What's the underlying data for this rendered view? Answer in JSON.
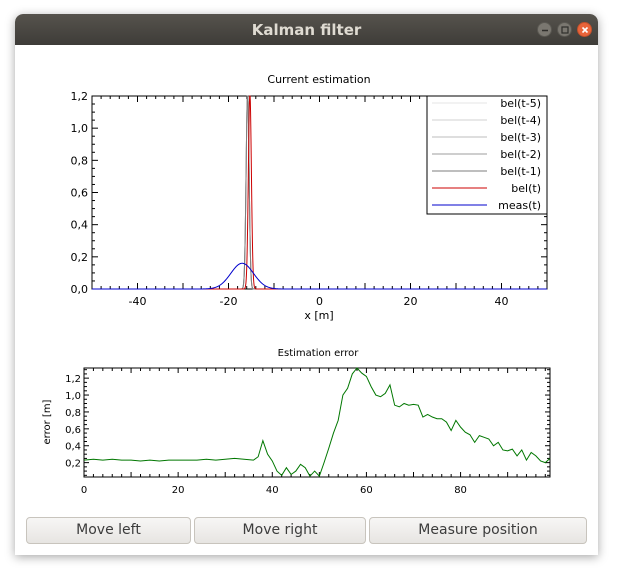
{
  "window": {
    "title": "Kalman filter"
  },
  "top_plot": {
    "title": "Current estimation",
    "xlabel": "x [m]",
    "x_ticks": [
      "-40",
      "-20",
      "0",
      "20",
      "40"
    ],
    "y_ticks": [
      "0,0",
      "0,2",
      "0,4",
      "0,6",
      "0,8",
      "1,0",
      "1,2"
    ],
    "legend": [
      {
        "label": "bel(t-5)",
        "color": "#e4e4e4"
      },
      {
        "label": "bel(t-4)",
        "color": "#d2d2d2"
      },
      {
        "label": "bel(t-3)",
        "color": "#bcbcbc"
      },
      {
        "label": "bel(t-2)",
        "color": "#9e9e9e"
      },
      {
        "label": "bel(t-1)",
        "color": "#7e7e7e"
      },
      {
        "label": "bel(t)",
        "color": "#cc0000"
      },
      {
        "label": "meas(t)",
        "color": "#0000cc"
      }
    ]
  },
  "bottom_plot": {
    "title": "Estimation error",
    "ylabel": "error [m]",
    "x_ticks": [
      "0",
      "20",
      "40",
      "60",
      "80"
    ],
    "y_ticks": [
      "0,2",
      "0,4",
      "0,6",
      "0,8",
      "1,0",
      "1,2"
    ],
    "line_color": "#007700"
  },
  "buttons": {
    "move_left": "Move left",
    "move_right": "Move right",
    "measure": "Measure position"
  },
  "chart_data": [
    {
      "type": "line",
      "title": "Current estimation",
      "xlabel": "x [m]",
      "ylabel": "",
      "xlim": [
        -50,
        50
      ],
      "ylim": [
        0,
        1.2
      ],
      "x_ticks": [
        -40,
        -20,
        0,
        20,
        40
      ],
      "y_ticks": [
        0,
        0.2,
        0.4,
        0.6,
        0.8,
        1.0,
        1.2
      ],
      "grid": false,
      "legend_position": "top-right",
      "series": [
        {
          "name": "bel(t-5)",
          "color": "#e4e4e4",
          "shape": "gaussian",
          "mean": -15.8,
          "sigma": 0.33,
          "peak": 1.22
        },
        {
          "name": "bel(t-4)",
          "color": "#d2d2d2",
          "shape": "gaussian",
          "mean": -15.8,
          "sigma": 0.33,
          "peak": 1.22
        },
        {
          "name": "bel(t-3)",
          "color": "#bcbcbc",
          "shape": "gaussian",
          "mean": -15.8,
          "sigma": 0.33,
          "peak": 1.22
        },
        {
          "name": "bel(t-2)",
          "color": "#9e9e9e",
          "shape": "gaussian",
          "mean": -15.8,
          "sigma": 0.33,
          "peak": 1.22
        },
        {
          "name": "bel(t-1)",
          "color": "#7e7e7e",
          "shape": "gaussian",
          "mean": -15.8,
          "sigma": 0.33,
          "peak": 1.22
        },
        {
          "name": "bel(t)",
          "color": "#cc0000",
          "shape": "gaussian",
          "mean": -15.3,
          "sigma": 0.33,
          "peak": 1.22
        },
        {
          "name": "meas(t)",
          "color": "#0000cc",
          "shape": "gaussian",
          "mean": -17.0,
          "sigma": 2.5,
          "peak": 0.16
        }
      ]
    },
    {
      "type": "line",
      "title": "Estimation error",
      "xlabel": "",
      "ylabel": "error [m]",
      "xlim": [
        0,
        99
      ],
      "ylim": [
        0.03,
        1.32
      ],
      "x_ticks": [
        0,
        20,
        40,
        60,
        80
      ],
      "y_ticks": [
        0.2,
        0.4,
        0.6,
        0.8,
        1.0,
        1.2
      ],
      "grid": false,
      "series": [
        {
          "color": "#007700",
          "x": [
            0,
            2,
            4,
            6,
            8,
            10,
            12,
            14,
            16,
            18,
            20,
            22,
            24,
            26,
            28,
            30,
            32,
            34,
            36,
            37,
            38,
            39,
            40,
            41,
            42,
            43,
            44,
            45,
            46,
            47,
            48,
            49,
            50,
            51,
            52,
            53,
            54,
            55,
            56,
            57,
            58,
            59,
            60,
            61,
            62,
            63,
            64,
            65,
            66,
            67,
            68,
            69,
            70,
            71,
            72,
            73,
            74,
            75,
            76,
            77,
            78,
            79,
            80,
            81,
            82,
            83,
            84,
            85,
            86,
            87,
            88,
            89,
            90,
            91,
            92,
            93,
            94,
            95,
            96,
            97,
            98,
            99
          ],
          "y": [
            0.23,
            0.24,
            0.23,
            0.24,
            0.23,
            0.23,
            0.22,
            0.23,
            0.22,
            0.23,
            0.23,
            0.23,
            0.23,
            0.24,
            0.23,
            0.24,
            0.25,
            0.24,
            0.23,
            0.27,
            0.46,
            0.3,
            0.22,
            0.1,
            0.05,
            0.14,
            0.06,
            0.1,
            0.18,
            0.14,
            0.04,
            0.1,
            0.04,
            0.2,
            0.37,
            0.55,
            0.7,
            1.0,
            1.08,
            1.25,
            1.32,
            1.26,
            1.22,
            1.1,
            1.0,
            0.98,
            1.02,
            1.12,
            0.88,
            0.86,
            0.9,
            0.88,
            0.89,
            0.88,
            0.74,
            0.77,
            0.74,
            0.72,
            0.72,
            0.68,
            0.58,
            0.7,
            0.62,
            0.56,
            0.53,
            0.44,
            0.52,
            0.5,
            0.48,
            0.4,
            0.44,
            0.35,
            0.34,
            0.36,
            0.28,
            0.35,
            0.23,
            0.32,
            0.28,
            0.22,
            0.2,
            0.25
          ]
        }
      ]
    }
  ]
}
